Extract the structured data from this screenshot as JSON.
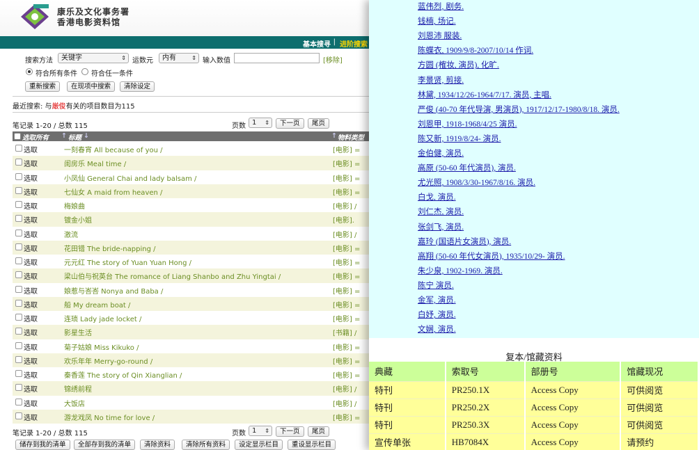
{
  "header": {
    "org_line1": "康乐及文化事务署",
    "org_line2": "香港电影资料馆",
    "nav_basic": "基本搜寻",
    "nav_sep": "|",
    "nav_advanced": "进阶搜索"
  },
  "search": {
    "method_label": "搜索方法",
    "method_value": "关键字",
    "operator_label": "运数元",
    "operator_value": "内有",
    "input_label": "输入数值",
    "input_value": "",
    "remove_link": "[移除]",
    "match_all": "符合所有条件",
    "match_any": "符合任一条件",
    "btn_research": "重新搜索",
    "btn_search_in": "在现项中搜索",
    "btn_clear": "清除设定"
  },
  "recent": {
    "prefix": "最近搜索: 与",
    "term": "厳俊",
    "suffix": "有关的项目数目为115"
  },
  "pager": {
    "record_text": "笔记录 1-20 / 总数 115",
    "page_label": "页数",
    "page_value": "1",
    "next": "下一页",
    "last": "尾页"
  },
  "table": {
    "col_select_all": "选取所有",
    "col_title": "标题",
    "col_type": "物料类型",
    "rows": [
      {
        "select": "选取",
        "title": "一刻春宵 All because of you /",
        "type": "[电影] ="
      },
      {
        "select": "选取",
        "title": "闺房乐 Meal time /",
        "type": "[电影] ="
      },
      {
        "select": "选取",
        "title": "小凤仙 General Chai and lady balsam /",
        "type": "[电影] ="
      },
      {
        "select": "选取",
        "title": "七仙女 A maid from heaven /",
        "type": "[电影] ="
      },
      {
        "select": "选取",
        "title": "梅娘曲",
        "type": "[电影] /"
      },
      {
        "select": "选取",
        "title": "镀金小姐",
        "type": "[电影]."
      },
      {
        "select": "选取",
        "title": "激流",
        "type": "[电影] /"
      },
      {
        "select": "选取",
        "title": "花田错 The bride-napping /",
        "type": "[电影] ="
      },
      {
        "select": "选取",
        "title": "元元红 The story of Yuan Yuan Hong /",
        "type": "[电影] ="
      },
      {
        "select": "选取",
        "title": "梁山伯与祝英台 The romance of Liang Shanbo and Zhu Yingtai /",
        "type": "[电影] ="
      },
      {
        "select": "选取",
        "title": "娘惹与峇峇 Nonya and Baba /",
        "type": "[电影] ="
      },
      {
        "select": "选取",
        "title": "船 My dream boat /",
        "type": "[电影] ="
      },
      {
        "select": "选取",
        "title": "连琐 Lady jade locket /",
        "type": "[电影] ="
      },
      {
        "select": "选取",
        "title": "影星生活",
        "type": "[书籍] /"
      },
      {
        "select": "选取",
        "title": "菊子姑娘 Miss Kikuko /",
        "type": "[电影] ="
      },
      {
        "select": "选取",
        "title": "欢乐年年 Merry-go-round /",
        "type": "[电影] ="
      },
      {
        "select": "选取",
        "title": "秦香莲 The story of Qin Xianglian /",
        "type": "[电影] ="
      },
      {
        "select": "选取",
        "title": "锦绣前程",
        "type": "[电影] /"
      },
      {
        "select": "选取",
        "title": "大饭店",
        "type": "[电影] /"
      },
      {
        "select": "选取",
        "title": "游龙戏凤 No time for love /",
        "type": "[电影] ="
      }
    ]
  },
  "footer_buttons": {
    "save_list": "储存到我的清单",
    "save_all": "全部存到我的清单",
    "clear_data": "清除资料",
    "clear_all": "清除所有资料",
    "set_columns": "设定显示栏目",
    "reset_columns": "重设显示栏目"
  },
  "people": [
    "蓝伟烈, 剧务.",
    "钱楠, 场记.",
    "刘恩沛 服装.",
    "陈蝶衣, 1909/9/8-2007/10/14 作词.",
    "方圆 (榷妆, 演员), 化旷.",
    "李景贤, 剪接.",
    "林黛, 1934/12/26-1964/7/17. 演员, 主唱.",
    "严俊 (40-70 年代导演, 男演员), 1917/12/17-1980/8/18. 演员.",
    "刘恩甲, 1918-1968/4/25 演员.",
    "陈又新, 1919/8/24- 演员.",
    "金伯健, 演员.",
    "高原 (50-60 年代演员), 演员.",
    "尤光照, 1908/3/30-1967/8/16. 演员.",
    "白戈, 演员.",
    "刘仁杰, 演员.",
    "张剑飞, 演员.",
    "嘉玲 (国语片女演员), 演员.",
    "高翔 (50-60 年代女演员), 1935/10/29- 演员.",
    "朱少泉, 1902-1969. 演员.",
    "陈宁 演员.",
    "金军, 演员.",
    "白妤, 演员.",
    "文娴, 演员."
  ],
  "copies": {
    "title": "复本/馆藏资料",
    "headers": [
      "典藏",
      "索取号",
      "部册号",
      "馆藏现况"
    ],
    "rows": [
      [
        "特刊",
        "PR250.1X",
        "Access Copy",
        "可供阅览"
      ],
      [
        "特刊",
        "PR250.2X",
        "Access Copy",
        "可供阅览"
      ],
      [
        "特刊",
        "PR250.3X",
        "Access Copy",
        "可供阅览"
      ],
      [
        "宣传单张",
        "HB7084X",
        "Access Copy",
        "请预约"
      ]
    ]
  }
}
